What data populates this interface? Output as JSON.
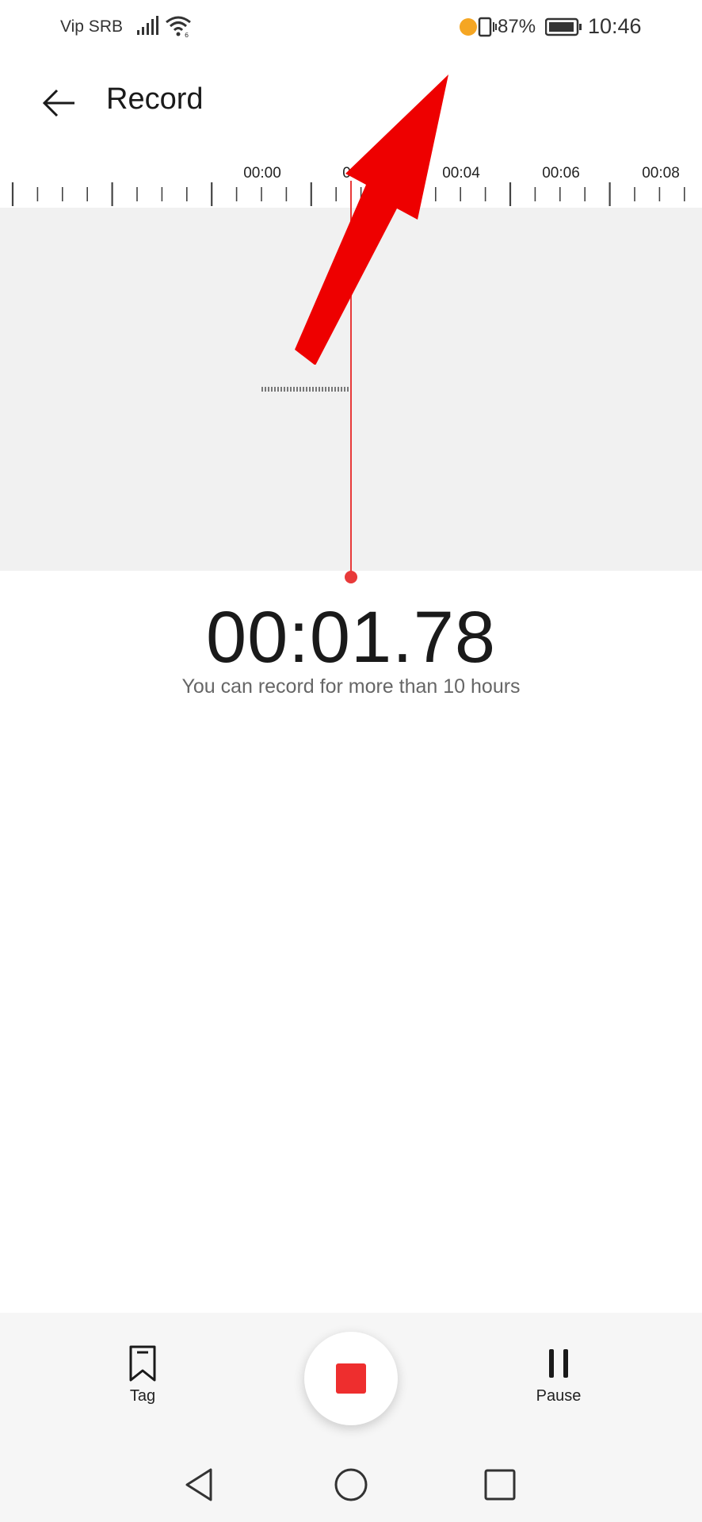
{
  "status_bar": {
    "carrier": "Vip SRB",
    "battery_percent": "87%",
    "time": "10:46",
    "icons": [
      "signal-icon",
      "wifi-icon",
      "notification-dot",
      "vibrate-icon",
      "battery-icon"
    ],
    "notification_color": "#f5a623"
  },
  "header": {
    "title": "Record",
    "back_icon": "arrow-left-icon"
  },
  "timeline": {
    "labels": [
      "00:00",
      "00:02",
      "00:04",
      "00:06",
      "00:08"
    ],
    "playhead_color": "#e83a3a"
  },
  "recorder": {
    "elapsed": "00:01.78",
    "hint": "You can record for more than 10 hours"
  },
  "controls": {
    "tag_label": "Tag",
    "tag_icon": "bookmark-icon",
    "stop_icon": "stop-icon",
    "stop_color": "#ee2e2e",
    "pause_label": "Pause",
    "pause_icon": "pause-icon"
  },
  "nav_bar": {
    "icons": [
      "nav-back-icon",
      "nav-home-icon",
      "nav-recent-icon"
    ]
  },
  "annotation": {
    "arrow_color": "#ee0000"
  }
}
